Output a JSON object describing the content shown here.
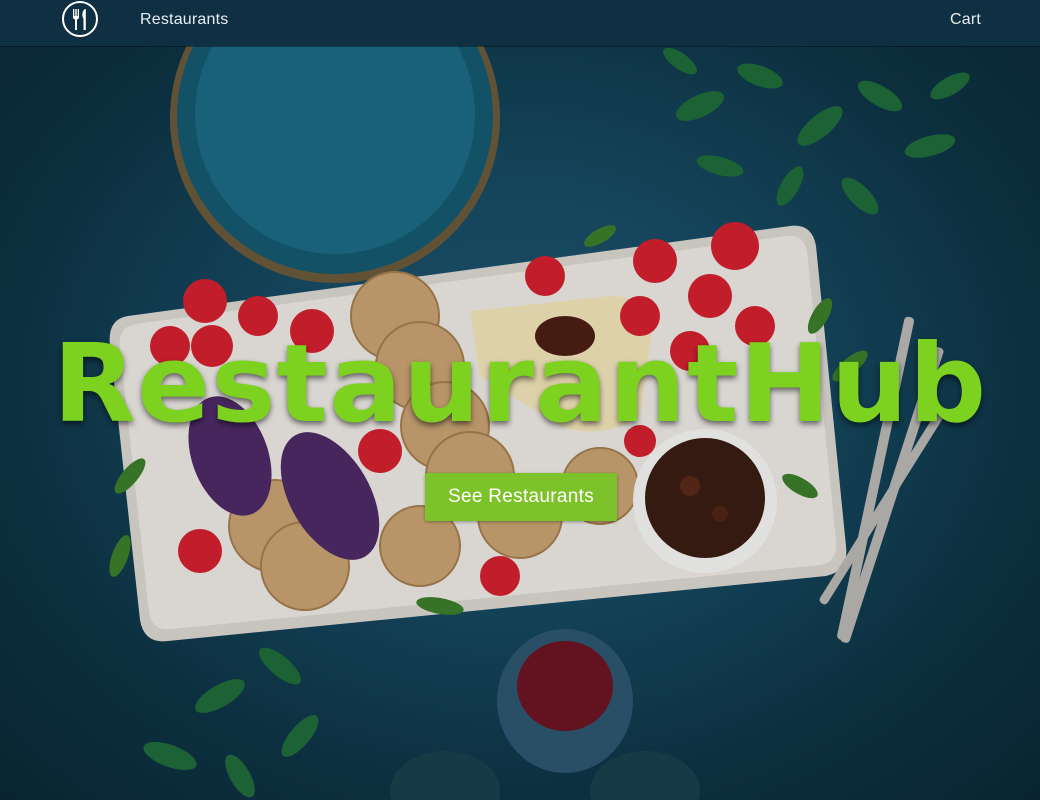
{
  "navbar": {
    "logo_icon": "fork-knife-plate-icon",
    "links": {
      "restaurants": "Restaurants",
      "cart": "Cart"
    }
  },
  "hero": {
    "title": "RestaurantHub",
    "button_label": "See Restaurants",
    "colors": {
      "title": "#7dd21f",
      "button": "#7dc22a",
      "background": "#164a62",
      "navbar": "#0f3042"
    }
  }
}
